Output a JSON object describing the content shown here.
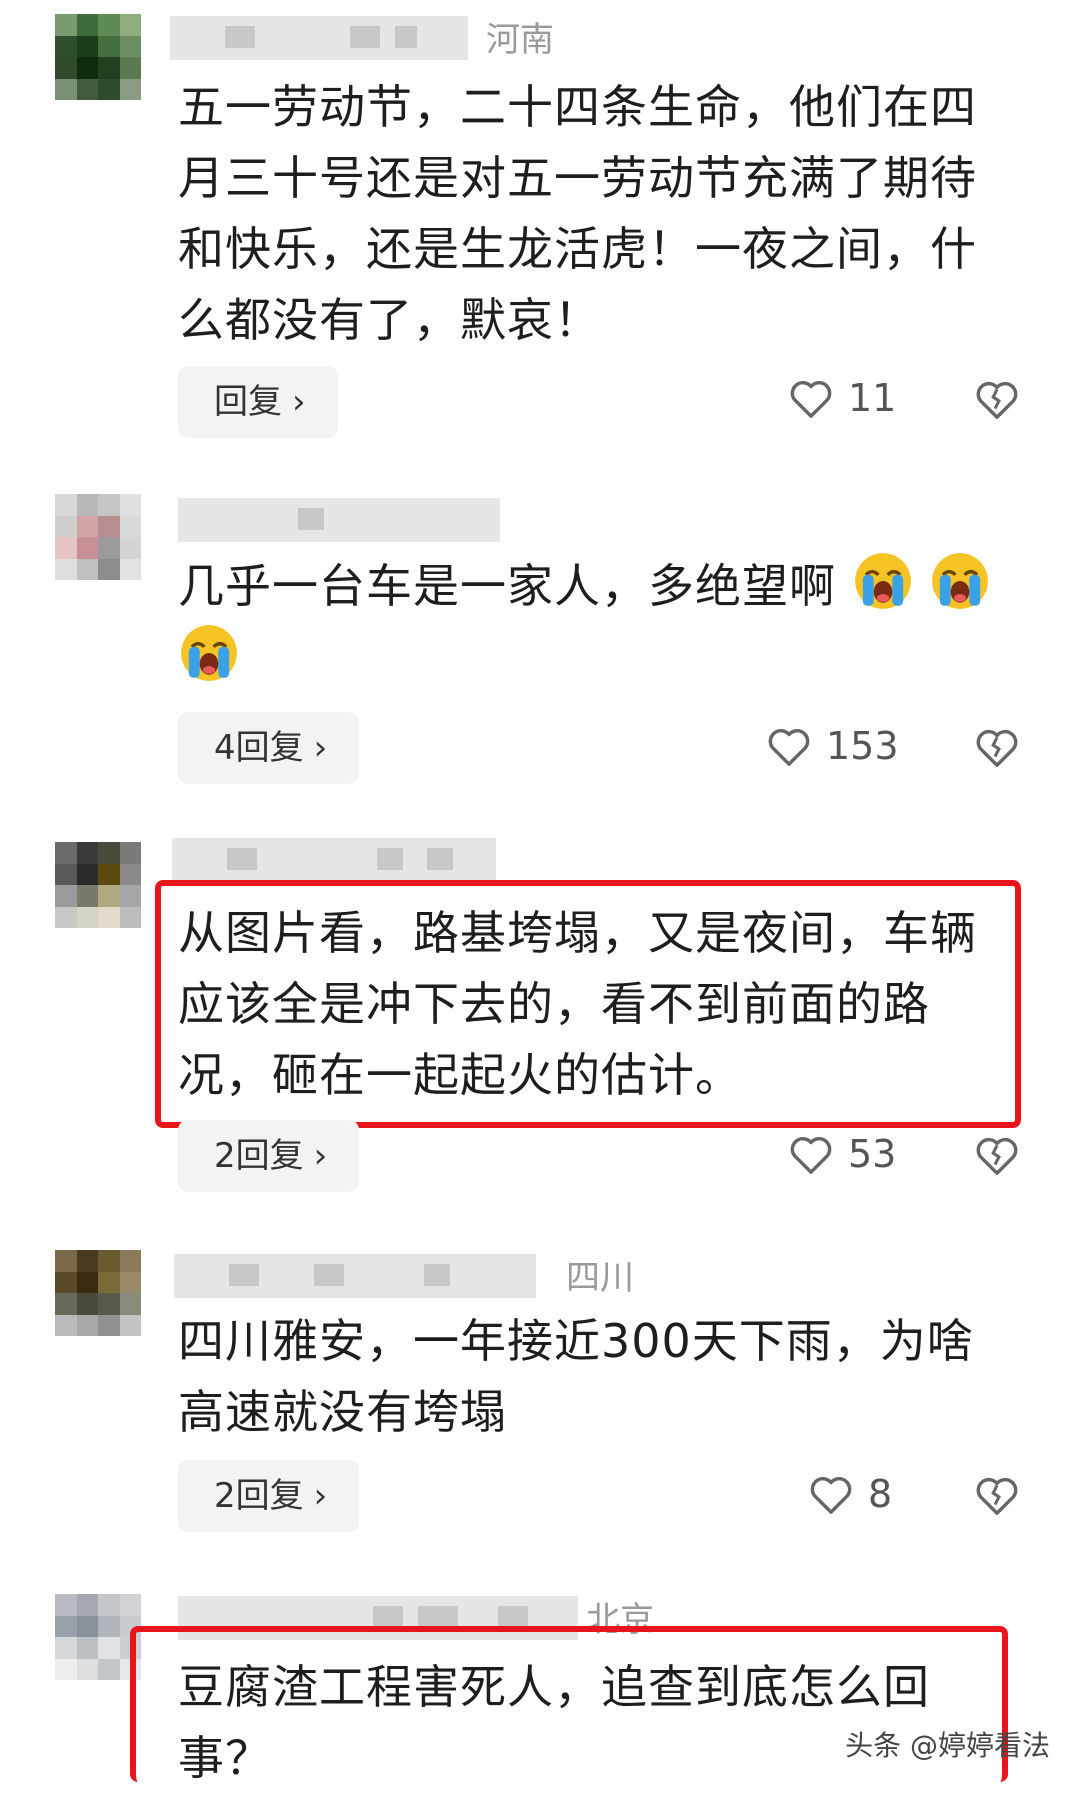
{
  "comments": [
    {
      "region": "河南",
      "text": "五一劳动节，二十四条生命，他们在四月三十号还是对五一劳动节充满了期待和快乐，还是生龙活虎！一夜之间，什么都没有了，默哀！",
      "reply_label": "回复",
      "likes": "11"
    },
    {
      "region": "",
      "text": "几乎一台车是一家人，多绝望啊",
      "reply_label": "4回复",
      "likes": "153"
    },
    {
      "region": "",
      "text": "从图片看，路基垮塌，又是夜间，车辆应该全是冲下去的，看不到前面的路况，砸在一起起火的估计。",
      "reply_label": "2回复",
      "likes": "53"
    },
    {
      "region": "四川",
      "text": "四川雅安，一年接近300天下雨，为啥高速就没有垮塌",
      "reply_label": "2回复",
      "likes": "8"
    },
    {
      "region": "北京",
      "text": "豆腐渣工程害死人，追查到底怎么回事？"
    }
  ],
  "icons": {
    "like": "heart-outline-icon",
    "dislike": "broken-heart-icon",
    "chevron": "chevron-right-icon",
    "emoji": "loudly-crying-face-icon"
  },
  "colors": {
    "highlight_box": "#e8151b",
    "reply_bg": "#f3f3f3"
  },
  "watermark": "头条 @婷婷看法"
}
